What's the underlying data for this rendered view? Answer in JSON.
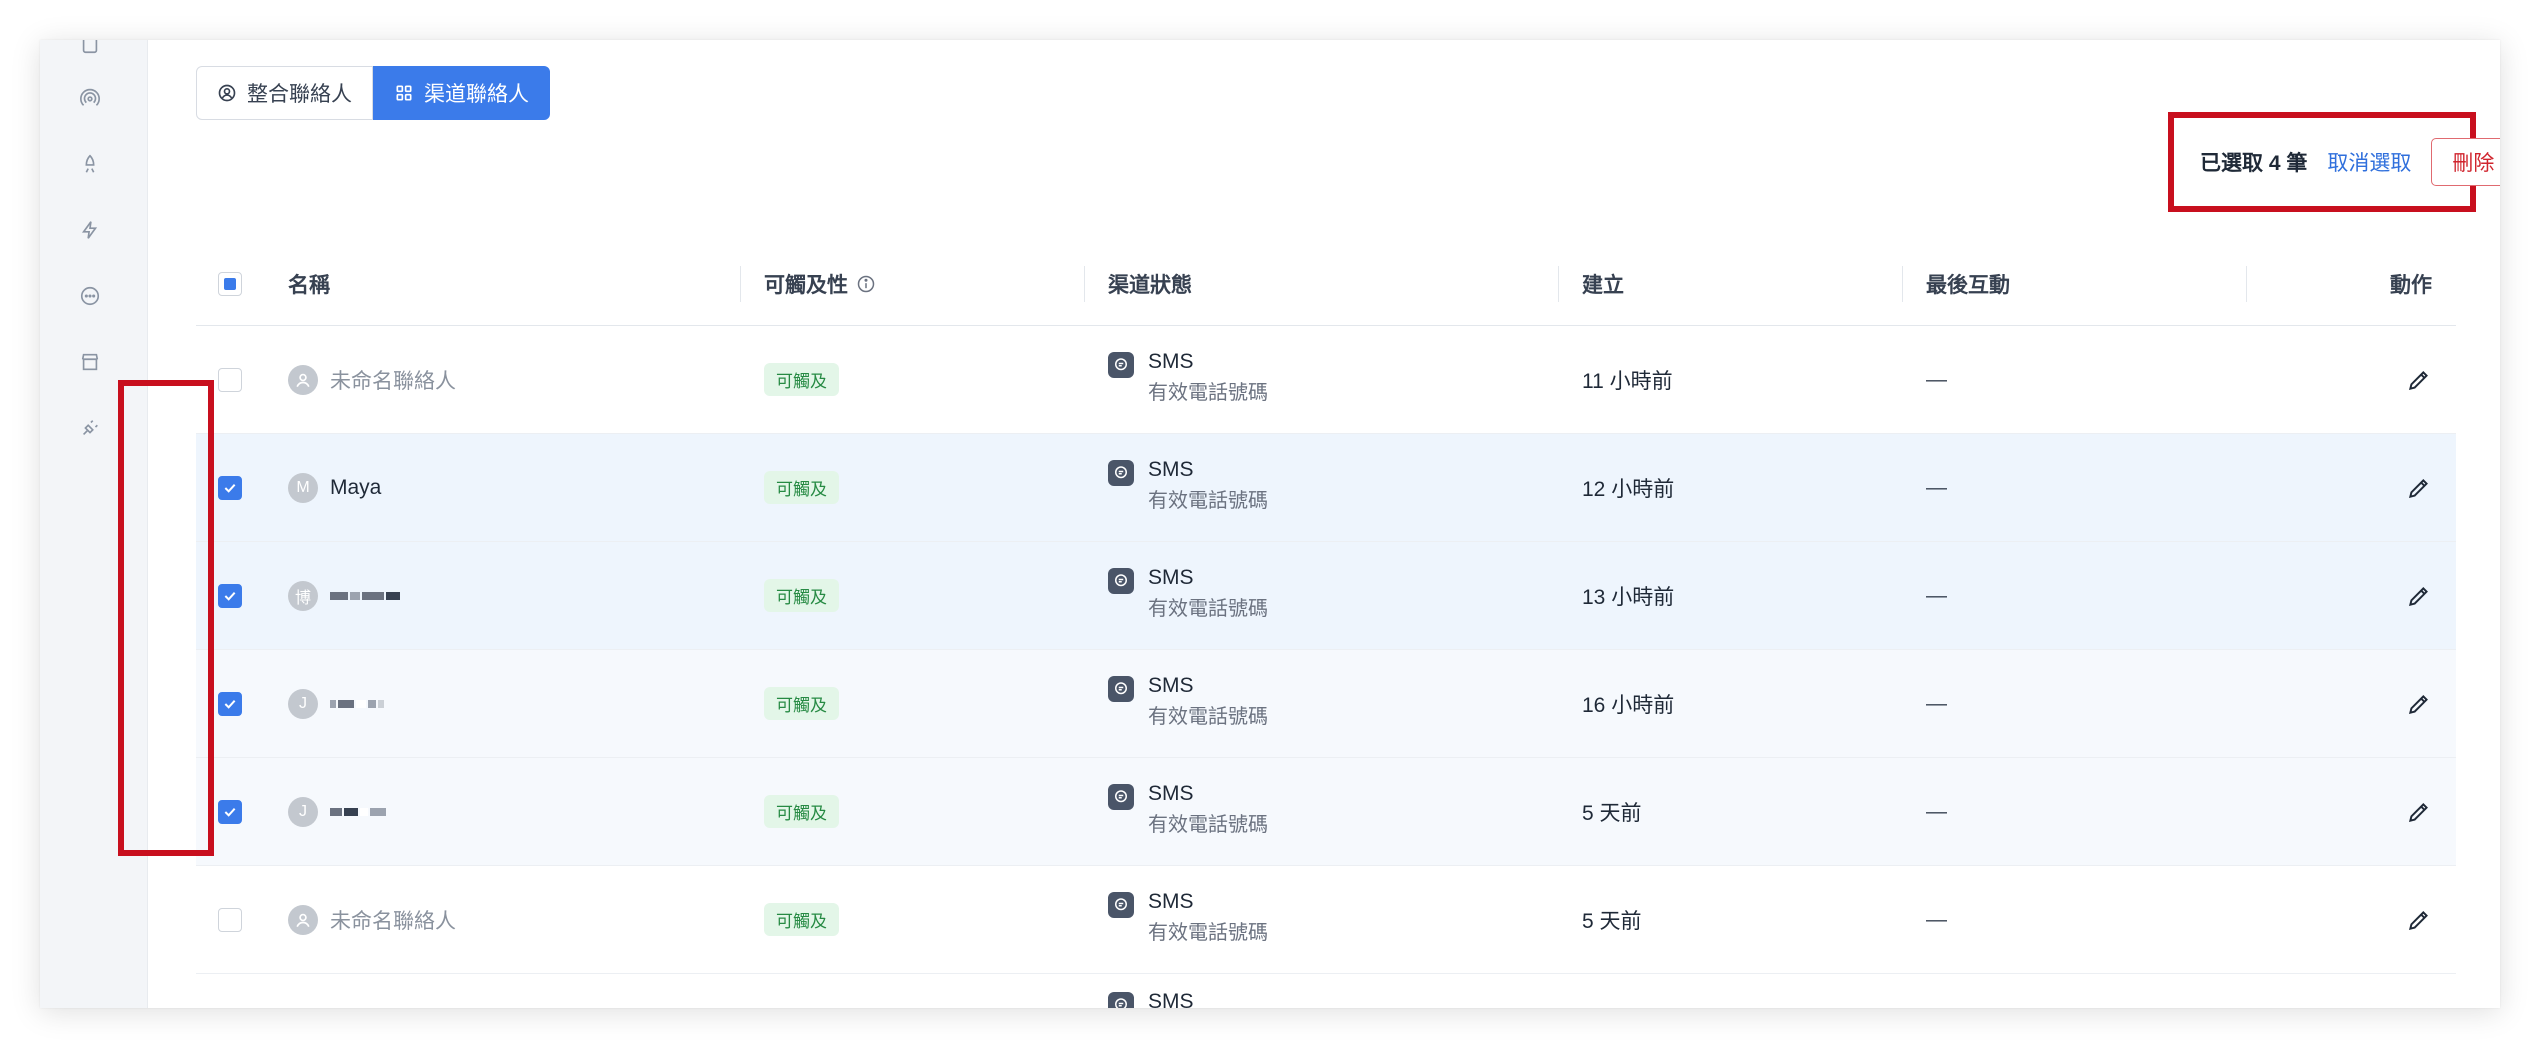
{
  "tabs": [
    {
      "label": "整合聯絡人",
      "icon": "person-circle-icon",
      "active": false
    },
    {
      "label": "渠道聯絡人",
      "icon": "grid-icon",
      "active": true
    }
  ],
  "selection": {
    "count_label": "已選取 4 筆",
    "cancel_label": "取消選取",
    "delete_label": "刪除"
  },
  "table": {
    "headers": {
      "name": "名稱",
      "reach": "可觸及性",
      "channel": "渠道狀態",
      "created": "建立",
      "last": "最後互動",
      "action": "動作"
    },
    "rows": [
      {
        "selected": false,
        "avatar": "",
        "avatar_icon": "person-icon",
        "name": "未命名聯絡人",
        "name_muted": true,
        "reach": "可觸及",
        "channel": "SMS",
        "channel_sub": "有效電話號碼",
        "created": "11 小時前",
        "last": "—"
      },
      {
        "selected": true,
        "avatar": "M",
        "name": "Maya",
        "name_muted": false,
        "reach": "可觸及",
        "channel": "SMS",
        "channel_sub": "有效電話號碼",
        "created": "12 小時前",
        "last": "—"
      },
      {
        "selected": true,
        "avatar": "博",
        "name": "",
        "name_muted": false,
        "reach": "可觸及",
        "channel": "SMS",
        "channel_sub": "有效電話號碼",
        "created": "13 小時前",
        "last": "—"
      },
      {
        "selected": true,
        "avatar": "J",
        "name": "",
        "name_muted": false,
        "reach": "可觸及",
        "channel": "SMS",
        "channel_sub": "有效電話號碼",
        "created": "16 小時前",
        "last": "—"
      },
      {
        "selected": true,
        "avatar": "J",
        "name": "",
        "name_muted": false,
        "reach": "可觸及",
        "channel": "SMS",
        "channel_sub": "有效電話號碼",
        "created": "5 天前",
        "last": "—"
      },
      {
        "selected": false,
        "avatar": "",
        "avatar_icon": "person-icon",
        "name": "未命名聯絡人",
        "name_muted": true,
        "reach": "可觸及",
        "channel": "SMS",
        "channel_sub": "有效電話號碼",
        "created": "5 天前",
        "last": "—"
      },
      {
        "selected": false,
        "avatar": "",
        "name": "",
        "name_muted": false,
        "reach": "",
        "channel": "SMS",
        "channel_sub": "",
        "created": "",
        "last": ""
      }
    ]
  },
  "colors": {
    "accent": "#3b7bea",
    "highlight": "#c80f1e",
    "reach_badge_bg": "#e3f6e8",
    "reach_badge_text": "#268a43",
    "selected_row": "#eef5fd"
  }
}
